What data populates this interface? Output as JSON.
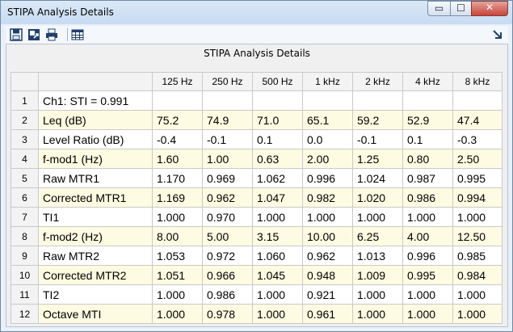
{
  "window": {
    "title": "STIPA Analysis Details"
  },
  "titlebar_buttons": {
    "minimize": "▭",
    "maximize": "☐",
    "close": "✕"
  },
  "toolbar": {
    "icons": [
      "save-icon",
      "export-icon",
      "print-icon",
      "table-icon",
      "expand-icon"
    ]
  },
  "panel": {
    "title": "STIPA Analysis Details"
  },
  "table": {
    "columns": [
      "125 Hz",
      "250 Hz",
      "500 Hz",
      "1 kHz",
      "2 kHz",
      "4 kHz",
      "8 kHz"
    ],
    "rows": [
      {
        "num": "1",
        "label": "Ch1: STI = 0.991",
        "values": [
          "",
          "",
          "",
          "",
          "",
          "",
          ""
        ]
      },
      {
        "num": "2",
        "label": "Leq (dB)",
        "values": [
          "75.2",
          "74.9",
          "71.0",
          "65.1",
          "59.2",
          "52.9",
          "47.4"
        ]
      },
      {
        "num": "3",
        "label": "Level Ratio (dB)",
        "values": [
          "-0.4",
          "-0.1",
          "0.1",
          "0.0",
          "-0.1",
          "0.1",
          "-0.3"
        ]
      },
      {
        "num": "4",
        "label": "f-mod1 (Hz)",
        "values": [
          "1.60",
          "1.00",
          "0.63",
          "2.00",
          "1.25",
          "0.80",
          "2.50"
        ]
      },
      {
        "num": "5",
        "label": "Raw MTR1",
        "values": [
          "1.170",
          "0.969",
          "1.062",
          "0.996",
          "1.024",
          "0.987",
          "0.995"
        ]
      },
      {
        "num": "6",
        "label": "Corrected MTR1",
        "values": [
          "1.169",
          "0.962",
          "1.047",
          "0.982",
          "1.020",
          "0.986",
          "0.994"
        ]
      },
      {
        "num": "7",
        "label": "TI1",
        "values": [
          "1.000",
          "0.970",
          "1.000",
          "1.000",
          "1.000",
          "1.000",
          "1.000"
        ]
      },
      {
        "num": "8",
        "label": "f-mod2 (Hz)",
        "values": [
          "8.00",
          "5.00",
          "3.15",
          "10.00",
          "6.25",
          "4.00",
          "12.50"
        ]
      },
      {
        "num": "9",
        "label": "Raw MTR2",
        "values": [
          "1.053",
          "0.972",
          "1.060",
          "0.962",
          "1.013",
          "0.996",
          "0.985"
        ]
      },
      {
        "num": "10",
        "label": "Corrected MTR2",
        "values": [
          "1.051",
          "0.966",
          "1.045",
          "0.948",
          "1.009",
          "0.995",
          "0.984"
        ]
      },
      {
        "num": "11",
        "label": "TI2",
        "values": [
          "1.000",
          "0.986",
          "1.000",
          "0.921",
          "1.000",
          "1.000",
          "1.000"
        ]
      },
      {
        "num": "12",
        "label": "Octave MTI",
        "values": [
          "1.000",
          "0.978",
          "1.000",
          "0.961",
          "1.000",
          "1.000",
          "1.000"
        ]
      }
    ]
  }
}
